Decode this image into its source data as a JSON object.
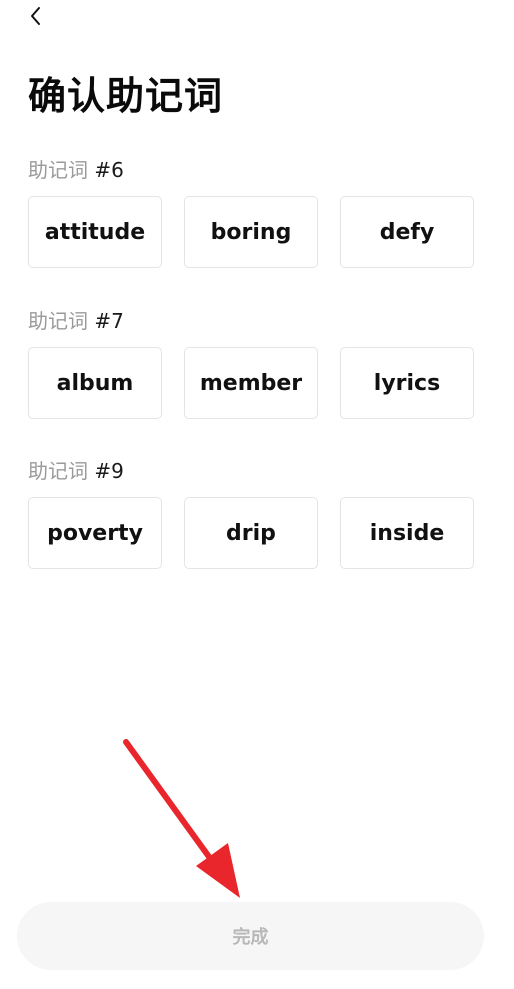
{
  "header": {
    "back_icon": "chevron-left-icon",
    "title": "确认助记词"
  },
  "groups": [
    {
      "label": "助记词",
      "index": "#6",
      "words": [
        "attitude",
        "boring",
        "defy"
      ]
    },
    {
      "label": "助记词",
      "index": "#7",
      "words": [
        "album",
        "member",
        "lyrics"
      ]
    },
    {
      "label": "助记词",
      "index": "#9",
      "words": [
        "poverty",
        "drip",
        "inside"
      ]
    }
  ],
  "footer": {
    "finish_label": "完成"
  },
  "colors": {
    "annotation_arrow": "#e8262c",
    "finish_bg": "#f6f6f6",
    "finish_text": "#b8b8b8",
    "label_gray": "#9a9a9a"
  }
}
